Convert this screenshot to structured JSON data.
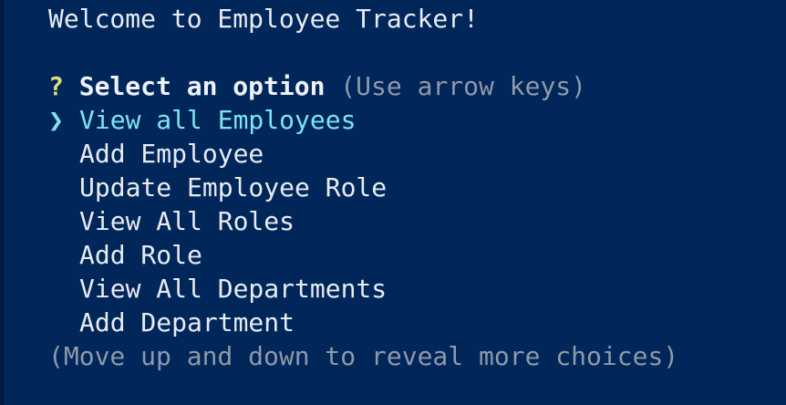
{
  "terminal": {
    "welcome": "Welcome to Employee Tracker!",
    "prompt": {
      "qmark": "?",
      "message": "Select an option",
      "hint": "(Use arrow keys)"
    },
    "pointer": "❯",
    "choices": [
      {
        "label": "View all Employees",
        "selected": true
      },
      {
        "label": "Add Employee",
        "selected": false
      },
      {
        "label": "Update Employee Role",
        "selected": false
      },
      {
        "label": "View All Roles",
        "selected": false
      },
      {
        "label": "Add Role",
        "selected": false
      },
      {
        "label": "View All Departments",
        "selected": false
      },
      {
        "label": "Add Department",
        "selected": false
      }
    ],
    "more_hint": "(Move up and down to reveal more choices)"
  },
  "colors": {
    "background": "#00265a",
    "text": "#e8ebf0",
    "qmark": "#d7e27a",
    "selected": "#7fe3f0",
    "hint": "#8f99a8"
  }
}
